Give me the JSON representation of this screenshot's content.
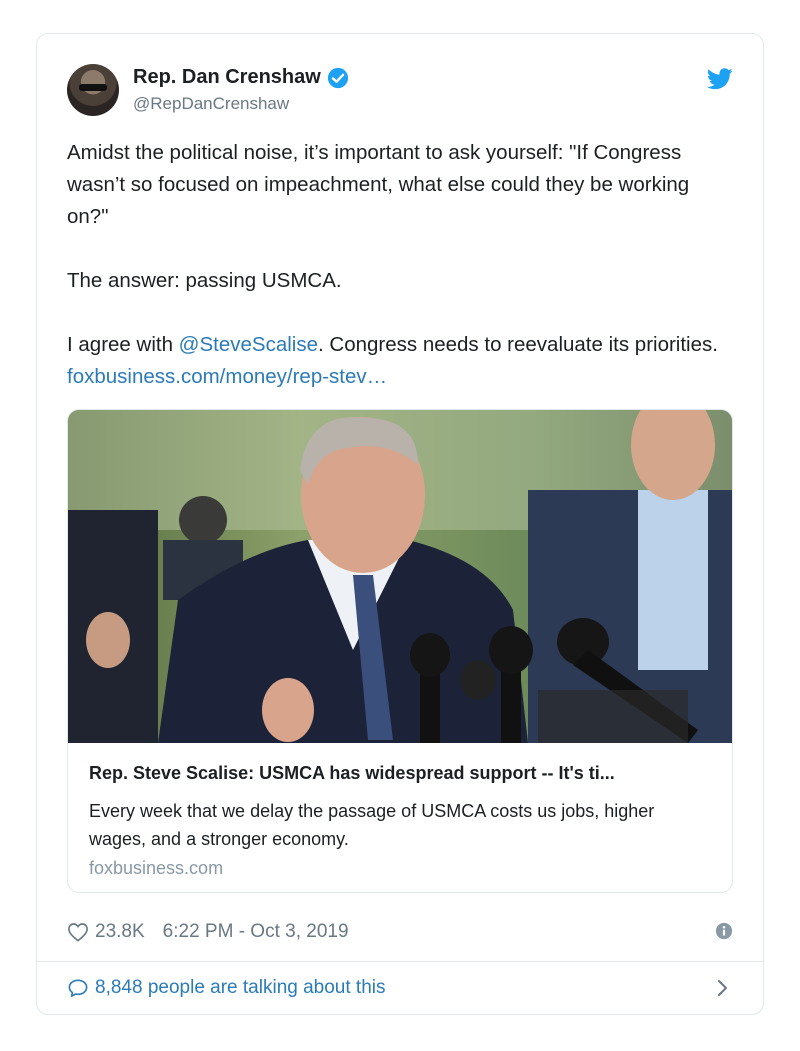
{
  "author": {
    "name": "Rep. Dan Crenshaw",
    "handle": "@RepDanCrenshaw",
    "verified": true,
    "verified_color": "#1da1f2"
  },
  "tweet": {
    "paragraph1": "Amidst the political noise, it’s important to ask yourself: \"If Congress wasn’t so focused on impeachment, what else could they be working on?\"",
    "paragraph2": "The answer: passing USMCA.",
    "paragraph3_prefix": "I agree with ",
    "mention": "@SteveScalise",
    "paragraph3_middle": ". Congress needs to reevaluate its priorities. ",
    "link_text": "foxbusiness.com/money/rep-stev…"
  },
  "link_card": {
    "title": "Rep. Steve Scalise: USMCA has widespread support -- It's ti...",
    "description": "Every week that we delay the passage of USMCA costs us jobs, higher wages, and a stronger economy.",
    "domain": "foxbusiness.com"
  },
  "meta": {
    "likes": "23.8K",
    "timestamp": "6:22 PM - Oct 3, 2019"
  },
  "talking": {
    "label": "8,848 people are talking about this"
  },
  "icons": {
    "brand": "twitter-bird-icon",
    "like": "heart-icon",
    "info": "info-icon",
    "reply": "speech-bubble-icon",
    "navigate": "chevron-right-icon"
  },
  "colors": {
    "link": "#2b7bb9",
    "brand": "#1da1f2",
    "muted": "#697882",
    "border": "#e1e8ed"
  }
}
